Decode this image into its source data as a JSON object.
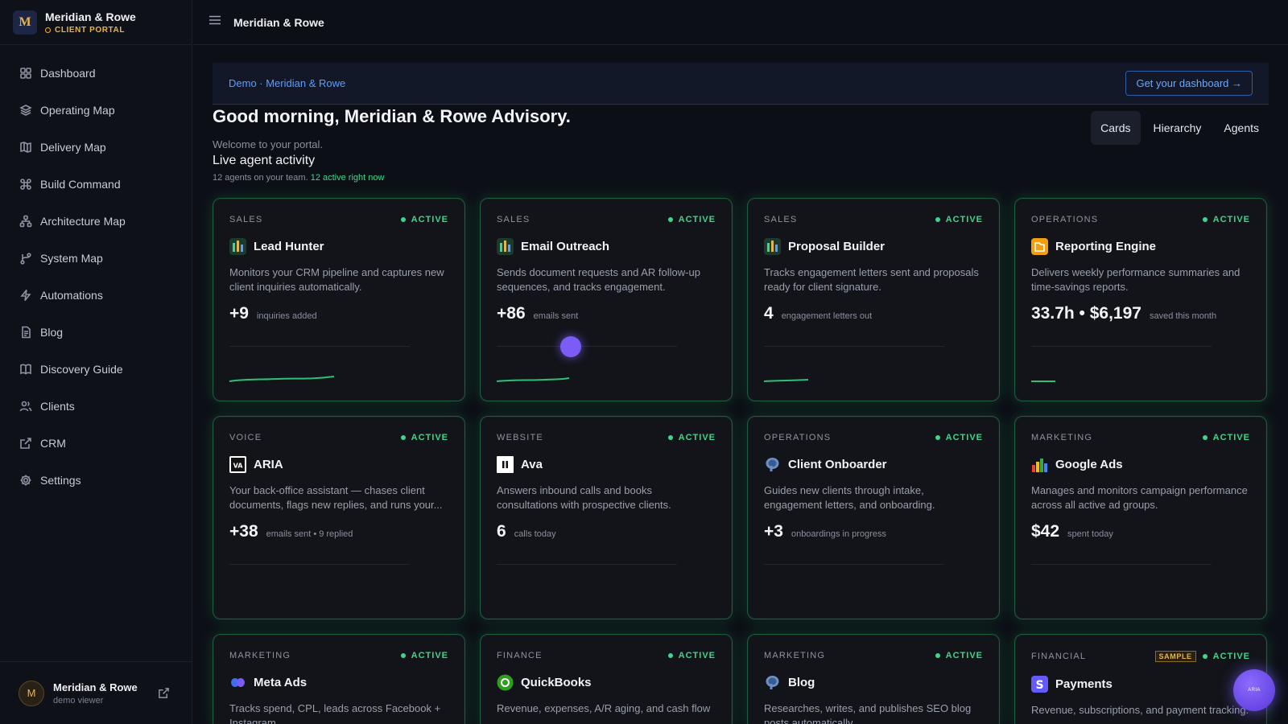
{
  "brand": {
    "logo_letter": "M",
    "name": "Meridian & Rowe",
    "subtitle": "CLIENT PORTAL"
  },
  "sidebar": {
    "items": [
      {
        "label": "Dashboard",
        "icon": "grid-icon"
      },
      {
        "label": "Operating Map",
        "icon": "layers-icon"
      },
      {
        "label": "Delivery Map",
        "icon": "map-icon"
      },
      {
        "label": "Build Command",
        "icon": "command-icon"
      },
      {
        "label": "Architecture Map",
        "icon": "network-icon"
      },
      {
        "label": "System Map",
        "icon": "branch-icon"
      },
      {
        "label": "Automations",
        "icon": "bolt-icon"
      },
      {
        "label": "Blog",
        "icon": "document-icon"
      },
      {
        "label": "Discovery Guide",
        "icon": "book-icon"
      },
      {
        "label": "Clients",
        "icon": "users-icon"
      },
      {
        "label": "CRM",
        "icon": "external-link-icon"
      },
      {
        "label": "Settings",
        "icon": "gear-icon"
      }
    ],
    "user": {
      "initial": "M",
      "name": "Meridian & Rowe",
      "role": "demo viewer"
    }
  },
  "topbar": {
    "title": "Meridian & Rowe"
  },
  "banner": {
    "text": "Demo · Meridian & Rowe",
    "button": "Get your dashboard →"
  },
  "main": {
    "greeting": "Good morning, Meridian & Rowe Advisory.",
    "welcome": "Welcome to your portal.",
    "live_title": "Live agent activity",
    "live_sub": "12 agents on your team.",
    "live_active": "12 active right now"
  },
  "view_tabs": [
    "Cards",
    "Hierarchy",
    "Agents"
  ],
  "colors": {
    "accent_green": "#3fd58a",
    "accent_blue": "#5d9cff",
    "brand_gold": "#e8b44a",
    "cursor_purple": "#7b5cf5"
  },
  "cards": [
    {
      "category": "SALES",
      "status": "ACTIVE",
      "icon": "bar-chart-icon",
      "title": "Lead Hunter",
      "desc": "Monitors your CRM pipeline and captures new client inquiries automatically.",
      "metric": "+9",
      "metric_label": "inquiries added"
    },
    {
      "category": "SALES",
      "status": "ACTIVE",
      "icon": "bar-chart-icon",
      "title": "Email Outreach",
      "desc": "Sends document requests and AR follow-up sequences, and tracks engagement.",
      "metric": "+86",
      "metric_label": "emails sent"
    },
    {
      "category": "SALES",
      "status": "ACTIVE",
      "icon": "bar-chart-icon",
      "title": "Proposal Builder",
      "desc": "Tracks engagement letters sent and proposals ready for client signature.",
      "metric": "4",
      "metric_label": "engagement letters out"
    },
    {
      "category": "OPERATIONS",
      "status": "ACTIVE",
      "icon": "report-icon",
      "title": "Reporting Engine",
      "desc": "Delivers weekly performance summaries and time-savings reports.",
      "metric": "33.7h • $6,197",
      "metric_label": "saved this month"
    },
    {
      "category": "VOICE",
      "status": "ACTIVE",
      "icon": "aria-logo-icon",
      "title": "ARIA",
      "desc": "Your back-office assistant — chases client documents, flags new replies, and runs your...",
      "metric": "+38",
      "metric_label": "emails sent • 9 replied"
    },
    {
      "category": "WEBSITE",
      "status": "ACTIVE",
      "icon": "pause-square-icon",
      "title": "Ava",
      "desc": "Answers inbound calls and books consultations with prospective clients.",
      "metric": "6",
      "metric_label": "calls today"
    },
    {
      "category": "OPERATIONS",
      "status": "ACTIVE",
      "icon": "elephant-icon",
      "title": "Client Onboarder",
      "desc": "Guides new clients through intake, engagement letters, and onboarding.",
      "metric": "+3",
      "metric_label": "onboardings in progress"
    },
    {
      "category": "MARKETING",
      "status": "ACTIVE",
      "icon": "google-ads-bars-icon",
      "title": "Google Ads",
      "desc": "Manages and monitors campaign performance across all active ad groups.",
      "metric": "$42",
      "metric_label": "spent today"
    },
    {
      "category": "MARKETING",
      "status": "ACTIVE",
      "icon": "meta-icon",
      "title": "Meta Ads",
      "desc": "Tracks spend, CPL, leads across Facebook + Instagram.",
      "metric": "",
      "metric_label": ""
    },
    {
      "category": "FINANCE",
      "status": "ACTIVE",
      "icon": "quickbooks-icon",
      "title": "QuickBooks",
      "desc": "Revenue, expenses, A/R aging, and cash flow",
      "metric": "",
      "metric_label": ""
    },
    {
      "category": "MARKETING",
      "status": "ACTIVE",
      "icon": "elephant-icon",
      "title": "Blog",
      "desc": "Researches, writes, and publishes SEO blog posts automatically.",
      "metric": "",
      "metric_label": ""
    },
    {
      "category": "FINANCIAL",
      "status": "ACTIVE",
      "badge": "SAMPLE",
      "icon": "stripe-icon",
      "title": "Payments",
      "desc": "Revenue, subscriptions, and payment tracking.",
      "metric": "",
      "metric_label": ""
    }
  ],
  "fab": {
    "label": "ARIA"
  }
}
